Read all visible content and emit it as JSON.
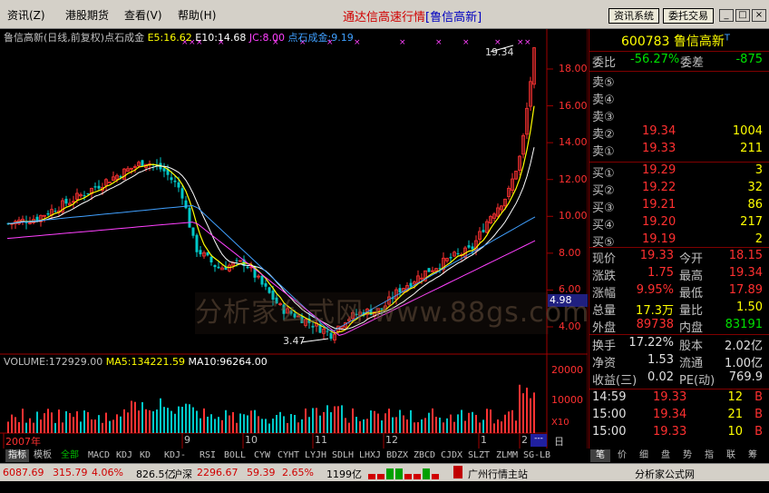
{
  "menu": {
    "items": [
      "资讯(Z)",
      "港股期货",
      "查看(V)",
      "帮助(H)"
    ]
  },
  "app_title": "通达信高速行情",
  "app_subtitle": "[鲁信高新]",
  "sys_buttons": {
    "info": "资讯系统",
    "trade": "委托交易"
  },
  "window_controls": [
    "_",
    "□",
    "×"
  ],
  "chart": {
    "header": "鲁信高新(日线,前复权)点石成金",
    "e5": "E5:16.62",
    "e10": "E10:14.68",
    "jc": "JC:8.00",
    "dscj": "点石成金:9.19",
    "high_label": "19.34",
    "low_label": "3.47",
    "price_axis": [
      "18.00",
      "16.00",
      "14.00",
      "12.00",
      "10.00",
      "8.00",
      "6.00",
      "4.00"
    ],
    "current_marker": "4.98",
    "x_labels": [
      "2007年",
      "9",
      "10",
      "11",
      "12",
      "1",
      "2"
    ],
    "volume_header": "VOLUME:172929.00",
    "ma5": "MA5:134221.59",
    "ma10": "MA10:96264.00",
    "vol_axis": [
      "20000",
      "10000"
    ],
    "vol_unit": "X10",
    "period": "日线",
    "watermark": "分析家公式网 www.88gs.com",
    "colors": {
      "up": "#ff3232",
      "down": "#00c8c8",
      "e5": "#ffff00",
      "e10": "#ffffff",
      "jc": "#ff40ff",
      "dscj": "#40a0ff"
    }
  },
  "tabs": [
    "指标",
    "模板",
    "全部",
    "MACD",
    "KDJ",
    "KD",
    "KDJ-TDX",
    "RSI",
    "BOLL",
    "CYW",
    "CYHT",
    "LYJH",
    "SDLH",
    "LHXJ",
    "BDZX",
    "ZBCD",
    "CJDX",
    "SLZT",
    "ZLMM",
    "SG-LB"
  ],
  "quote": {
    "code": "600783",
    "name": "鲁信高新",
    "name_suffix": "T",
    "weibi_label": "委比",
    "weibi": "-56.27%",
    "weicha_label": "委差",
    "weicha": "-875",
    "asks": [
      {
        "label": "卖⑤",
        "price": "",
        "vol": ""
      },
      {
        "label": "卖④",
        "price": "",
        "vol": ""
      },
      {
        "label": "卖③",
        "price": "",
        "vol": ""
      },
      {
        "label": "卖②",
        "price": "19.34",
        "vol": "1004"
      },
      {
        "label": "卖①",
        "price": "19.33",
        "vol": "211"
      }
    ],
    "bids": [
      {
        "label": "买①",
        "price": "19.29",
        "vol": "3"
      },
      {
        "label": "买②",
        "price": "19.22",
        "vol": "32"
      },
      {
        "label": "买③",
        "price": "19.21",
        "vol": "86"
      },
      {
        "label": "买④",
        "price": "19.20",
        "vol": "217"
      },
      {
        "label": "买⑤",
        "price": "19.19",
        "vol": "2"
      }
    ],
    "stats": [
      {
        "l1": "现价",
        "v1": "19.33",
        "c1": "red",
        "l2": "今开",
        "v2": "18.15",
        "c2": "red"
      },
      {
        "l1": "涨跌",
        "v1": "1.75",
        "c1": "red",
        "l2": "最高",
        "v2": "19.34",
        "c2": "red"
      },
      {
        "l1": "涨幅",
        "v1": "9.95%",
        "c1": "red",
        "l2": "最低",
        "v2": "17.89",
        "c2": "red"
      },
      {
        "l1": "总量",
        "v1": "17.3万",
        "c1": "yel",
        "l2": "量比",
        "v2": "1.50",
        "c2": "yel"
      },
      {
        "l1": "外盘",
        "v1": "89738",
        "c1": "red",
        "l2": "内盘",
        "v2": "83191",
        "c2": "grn"
      }
    ],
    "stats2": [
      {
        "l1": "换手",
        "v1": "17.22%",
        "l2": "股本",
        "v2": "2.02亿"
      },
      {
        "l1": "净资",
        "v1": "1.53",
        "l2": "流通",
        "v2": "1.00亿"
      },
      {
        "l1": "收益(三)",
        "v1": "0.02",
        "l2": "PE(动)",
        "v2": "769.9"
      }
    ],
    "ticks": [
      {
        "time": "14:59",
        "price": "19.33",
        "vol": "12",
        "side": "B"
      },
      {
        "time": "15:00",
        "price": "19.34",
        "vol": "21",
        "side": "B"
      },
      {
        "time": "15:00",
        "price": "19.33",
        "vol": "10",
        "side": "B"
      }
    ],
    "rtabs": [
      "笔",
      "价",
      "细",
      "盘",
      "势",
      "指",
      "联",
      "筹"
    ]
  },
  "status": {
    "sh_index": "6087.69",
    "sh_chg": "315.79",
    "sh_pct": "4.06%",
    "sh_amt": "826.5亿",
    "sz_label": "沪深",
    "sz_index": "2296.67",
    "sz_chg": "59.39",
    "sz_pct": "2.65%",
    "sz_amt": "1199亿",
    "station": "广州行情主站",
    "brand": "分析家公式网 www.88gs.com"
  }
}
